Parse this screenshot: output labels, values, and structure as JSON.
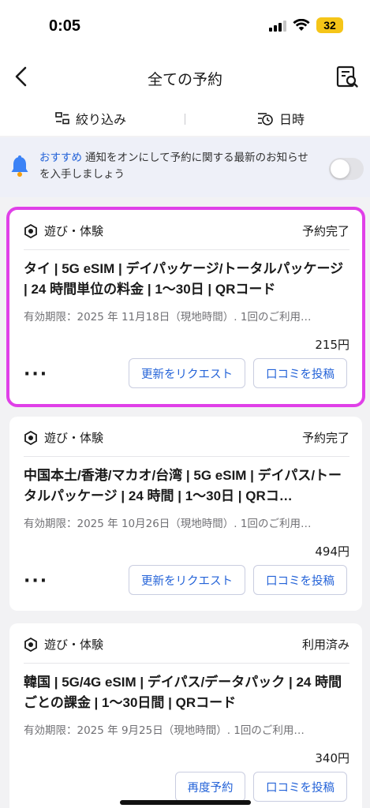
{
  "status_bar": {
    "time": "0:05",
    "battery": "32"
  },
  "header": {
    "title": "全ての予約"
  },
  "filters": {
    "filter_label": "絞り込み",
    "date_label": "日時"
  },
  "notice": {
    "tag": "おすすめ",
    "text": "通知をオンにして予約に関する最新のお知らせを入手しましょう",
    "toggle_on": false
  },
  "bookings": [
    {
      "category": "遊び・体験",
      "status": "予約完了",
      "title": "タイ | 5G eSIM | デイパッケージ/トータルパッケージ | 24 時間単位の料金 | 1～30日 | QRコード",
      "validity": "有効期限：2025 年 11月18日（現地時間）. 1回のご利用…",
      "price": "215円",
      "more": "···",
      "buttons": [
        "更新をリクエスト",
        "口コミを投稿"
      ]
    },
    {
      "category": "遊び・体験",
      "status": "予約完了",
      "title": "中国本土/香港/マカオ/台湾 | 5G eSIM | デイパス/トータルパッケージ | 24 時間 | 1～30日 | QRコ…",
      "validity": "有効期限：2025 年 10月26日（現地時間）. 1回のご利用…",
      "price": "494円",
      "more": "···",
      "buttons": [
        "更新をリクエスト",
        "口コミを投稿"
      ]
    },
    {
      "category": "遊び・体験",
      "status": "利用済み",
      "title": "韓国 | 5G/4G eSIM | デイパス/データパック | 24 時間ごとの課金 | 1～30日間 | QRコード",
      "validity": "有効期限：2025 年 9月25日（現地時間）. 1回のご利用…",
      "price": "340円",
      "buttons": [
        "再度予約",
        "口コミを投稿"
      ]
    }
  ],
  "colors": {
    "accent": "#2463d8",
    "highlight": "#e040e8",
    "battery": "#f5c518"
  }
}
